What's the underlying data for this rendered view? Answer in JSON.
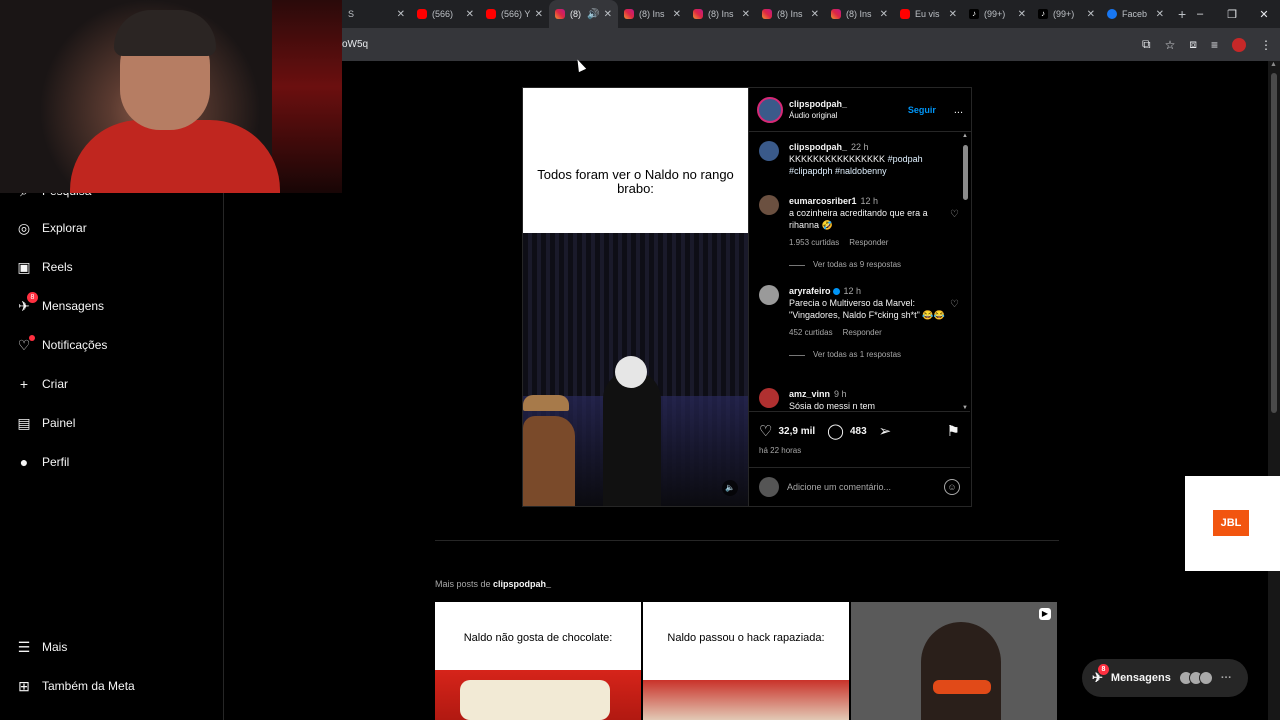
{
  "browser": {
    "tabs": [
      {
        "favicon": "generic-tab",
        "title": "S"
      },
      {
        "favicon": "youtube",
        "title": "(566)"
      },
      {
        "favicon": "youtube",
        "title": "(566) Y"
      },
      {
        "favicon": "instagram",
        "title": "(8)",
        "active": true
      },
      {
        "favicon": "instagram",
        "title": "(8) Ins"
      },
      {
        "favicon": "instagram",
        "title": "(8) Ins"
      },
      {
        "favicon": "instagram",
        "title": "(8) Ins"
      },
      {
        "favicon": "instagram",
        "title": "(8) Ins"
      },
      {
        "favicon": "youtube",
        "title": "Eu vis"
      },
      {
        "favicon": "tiktok",
        "title": "(99+)"
      },
      {
        "favicon": "tiktok",
        "title": "(99+)"
      },
      {
        "favicon": "facebook",
        "title": "Faceb"
      }
    ],
    "new_tab": "+",
    "window_controls": [
      "–",
      "❐",
      "✕"
    ],
    "url": "oW5q"
  },
  "nav": {
    "items": [
      {
        "key": "pesquisa",
        "label": "Pesquisa",
        "icon": "search-icon"
      },
      {
        "key": "explorar",
        "label": "Explorar",
        "icon": "compass-icon"
      },
      {
        "key": "reels",
        "label": "Reels",
        "icon": "reels-icon"
      },
      {
        "key": "mensagens",
        "label": "Mensagens",
        "icon": "messenger-icon",
        "badge": "8"
      },
      {
        "key": "notificacoes",
        "label": "Notificações",
        "icon": "heart-icon",
        "dot": true
      },
      {
        "key": "criar",
        "label": "Criar",
        "icon": "plus-icon"
      },
      {
        "key": "painel",
        "label": "Painel",
        "icon": "dashboard-icon"
      },
      {
        "key": "perfil",
        "label": "Perfil",
        "icon": "profile-avatar"
      },
      {
        "key": "mais",
        "label": "Mais",
        "icon": "menu-icon"
      },
      {
        "key": "meta",
        "label": "Também da Meta",
        "icon": "meta-icon"
      }
    ]
  },
  "post": {
    "media_caption": "Todos foram ver o Naldo no rango brabo:",
    "author": "clipspodpah_",
    "audio": "Áudio original",
    "follow": "Seguir",
    "more": "...",
    "caption": {
      "user": "clipspodpah_",
      "time": "22 h",
      "text": "KKKKKKKKKKKKKKKK",
      "tags": "#podpah #clipapdph #naldobenny"
    },
    "comments": [
      {
        "user": "eumarcosriber1",
        "time": "12 h",
        "text": "a cozinheira acreditando que era a rihanna 🤣",
        "likes": "1.953 curtidas",
        "reply": "Responder",
        "replies": "Ver todas as 9 respostas"
      },
      {
        "user": "aryrafeiro",
        "time": "12 h",
        "verified": true,
        "text": "Parecia o Multiverso da Marvel: \"Vingadores, Naldo F*cking sh*t\" 😂😂",
        "likes": "452 curtidas",
        "reply": "Responder",
        "replies": "Ver todas as 1 respostas"
      },
      {
        "user": "amz_vinn",
        "time": "9 h",
        "text": "Sósia do messi n tem"
      }
    ],
    "likes": "32,9 mil",
    "comment_count": "483",
    "posted": "há 22 horas",
    "add_comment_placeholder": "Adicione um comentário..."
  },
  "more_posts": {
    "prefix": "Mais posts de",
    "user": "clipspodpah_",
    "items": [
      {
        "caption": "Naldo não gosta de chocolate:"
      },
      {
        "caption": "Naldo passou o hack rapaziada:"
      },
      {
        "caption": ""
      }
    ]
  },
  "overlay": {
    "jbl_logo": "JBL"
  },
  "messages_pill": {
    "label": "Mensagens",
    "badge": "8"
  },
  "colors": {
    "accent_blue": "#0095f6",
    "notification_red": "#ff3040",
    "background": "#000000"
  }
}
